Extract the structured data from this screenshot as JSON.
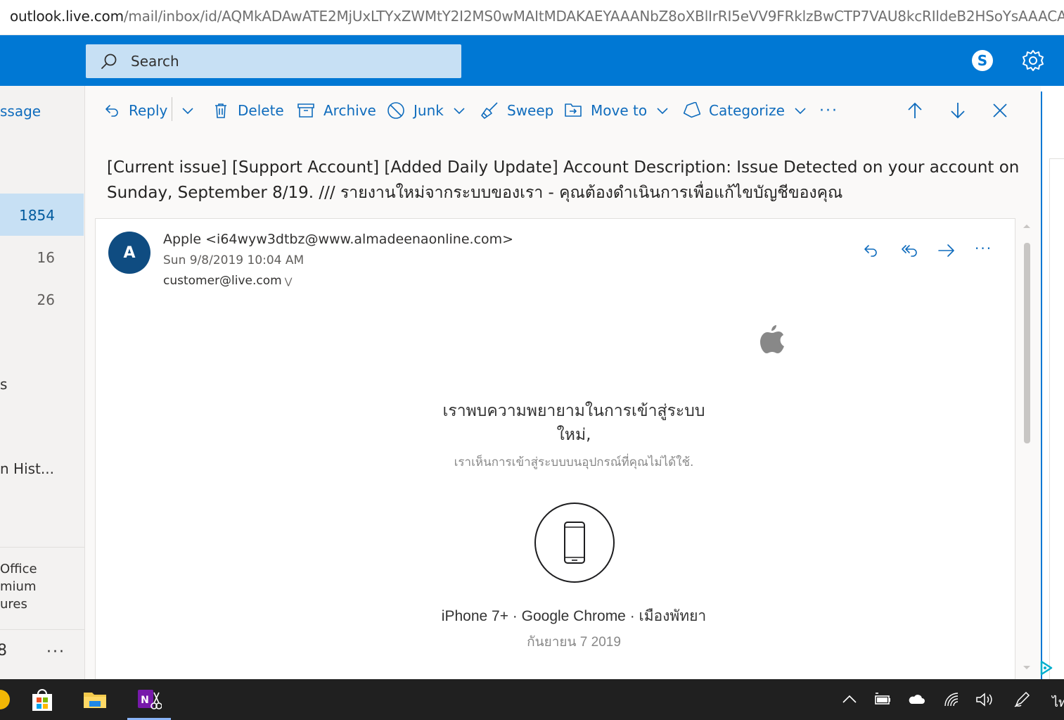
{
  "browser": {
    "url_host": "outlook.live.com",
    "url_path": "/mail/inbox/id/AQMkADAwATE2MjUxLTYxZWMtY2I2MS0wMAItMDAKAEYAAANbZ8oXBlIrRI5eVV9FRklzBwCTP7VAU8kcRIldeB2HSoYsAAACAQwAA"
  },
  "header": {
    "search_placeholder": "Search",
    "brand_color": "#0078d4"
  },
  "left_pane": {
    "new_message_fragment": "ssage",
    "folders": [
      {
        "count": "1854",
        "selected": true
      },
      {
        "count": "16"
      },
      {
        "count": "26"
      }
    ],
    "fragment_1": "s",
    "fragment_2": "n Hist...",
    "promo": [
      "Office",
      "mium",
      "ures"
    ],
    "bottom_glyph": "8",
    "more": "···"
  },
  "toolbar": {
    "reply": "Reply",
    "delete": "Delete",
    "archive": "Archive",
    "junk": "Junk",
    "sweep": "Sweep",
    "move_to": "Move to",
    "categorize": "Categorize",
    "more": "···"
  },
  "email": {
    "subject": "[Current issue] [Support Account] [Added Daily Update] Account Description: Issue Detected on your account on Sunday, September 8/19. /// รายงานใหม่จากระบบของเรา - คุณต้องดำเนินการเพื่อแก้ไขบัญชีของคุณ",
    "avatar_letter": "A",
    "sender": "Apple <i64wyw3dtbz@www.almadeenaonline.com>",
    "date": "Sun 9/8/2019 10:04 AM",
    "recipient": "customer@live.com",
    "more": "···"
  },
  "body": {
    "title_line1": "เราพบความพยายามในการเข้าสู่ระบบ",
    "title_line2": "ใหม่,",
    "subtitle": "เราเห็นการเข้าสู่ระบบบนอุปกรณ์ที่คุณไม่ได้ใช้.",
    "device": "iPhone 7+ · Google Chrome · เมืองพัทยา",
    "device_date": "กันยายน 7 2019"
  },
  "taskbar": {
    "tray_fragment": "ไท"
  }
}
